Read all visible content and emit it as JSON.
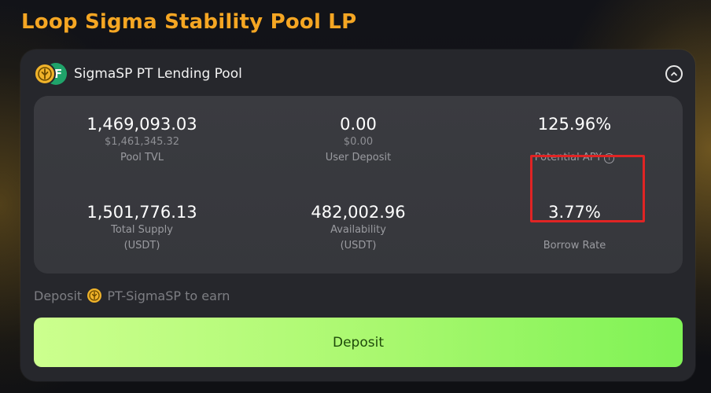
{
  "page": {
    "title": "Loop Sigma Stability Pool LP"
  },
  "pool": {
    "name": "SigmaSP PT Lending Pool",
    "logo_back_letter": "F",
    "icons": {
      "logo": "sigma-coin-icon",
      "collapse": "chevron-up-icon",
      "info": "info-icon"
    }
  },
  "stats": {
    "pool_tvl": {
      "value": "1,469,093.03",
      "sub": "$1,461,345.32",
      "label": "Pool TVL"
    },
    "user_deposit": {
      "value": "0.00",
      "sub": "$0.00",
      "label": "User Deposit"
    },
    "potential_apy": {
      "value": "125.96%",
      "label": "Potential APY",
      "info_glyph": "i"
    },
    "total_supply": {
      "value": "1,501,776.13",
      "label_line1": "Total Supply",
      "label_line2": "(USDT)"
    },
    "availability": {
      "value": "482,002.96",
      "label_line1": "Availability",
      "label_line2": "(USDT)"
    },
    "borrow_rate": {
      "value": "3.77%",
      "label": "Borrow Rate"
    }
  },
  "deposit": {
    "hint_prefix": "Deposit",
    "hint_token": "PT-SigmaSP",
    "hint_suffix": "to earn",
    "button_label": "Deposit"
  },
  "colors": {
    "title_accent": "#f5a623",
    "highlight": "#e02424",
    "button_start": "#ccff8e",
    "button_end": "#7ff255"
  }
}
